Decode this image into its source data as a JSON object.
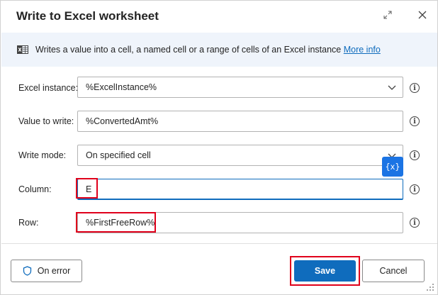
{
  "dialog": {
    "title": "Write to Excel worksheet",
    "expand_icon": "expand-icon",
    "close_icon": "close-icon"
  },
  "info": {
    "text": "Writes a value into a cell, a named cell or a range of cells of an Excel instance",
    "link": "More info",
    "icon": "excel-icon"
  },
  "fields": {
    "excel_instance": {
      "label": "Excel instance:",
      "value": "%ExcelInstance%"
    },
    "value_to_write": {
      "label": "Value to write:",
      "value": "%ConvertedAmt%"
    },
    "write_mode": {
      "label": "Write mode:",
      "value": "On specified cell"
    },
    "column": {
      "label": "Column:",
      "value": "E"
    },
    "row": {
      "label": "Row:",
      "value": "%FirstFreeRow%"
    }
  },
  "variable_button": {
    "label": "{x}"
  },
  "footer": {
    "on_error": "On error",
    "save": "Save",
    "cancel": "Cancel"
  },
  "colors": {
    "accent": "#0f6cbd",
    "highlight": "#e0001b",
    "variable_button": "#1b74e4",
    "info_bar": "#eff4fb"
  }
}
